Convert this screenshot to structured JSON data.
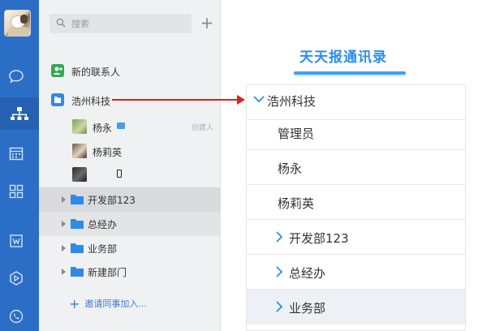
{
  "sidebar": {
    "search_placeholder": "搜索",
    "new_contacts": "新的联系人",
    "company": "浩州科技",
    "members": [
      {
        "name": "杨永",
        "role": "创建人"
      },
      {
        "name": "杨莉英",
        "role": ""
      },
      {
        "name": "",
        "role": ""
      }
    ],
    "departments": [
      "开发部123",
      "总经办",
      "业务部",
      "新建部门"
    ],
    "invite": "邀请同事加入..."
  },
  "panel": {
    "title": "天天报通讯录",
    "company": "浩州科技",
    "rows": [
      "管理员",
      "杨永",
      "杨莉英"
    ],
    "departments": [
      "开发部123",
      "总经办",
      "业务部"
    ]
  },
  "colors": {
    "rail": "#2b6ec6",
    "title": "#2a8ef0",
    "arrow": "#d9221c"
  }
}
